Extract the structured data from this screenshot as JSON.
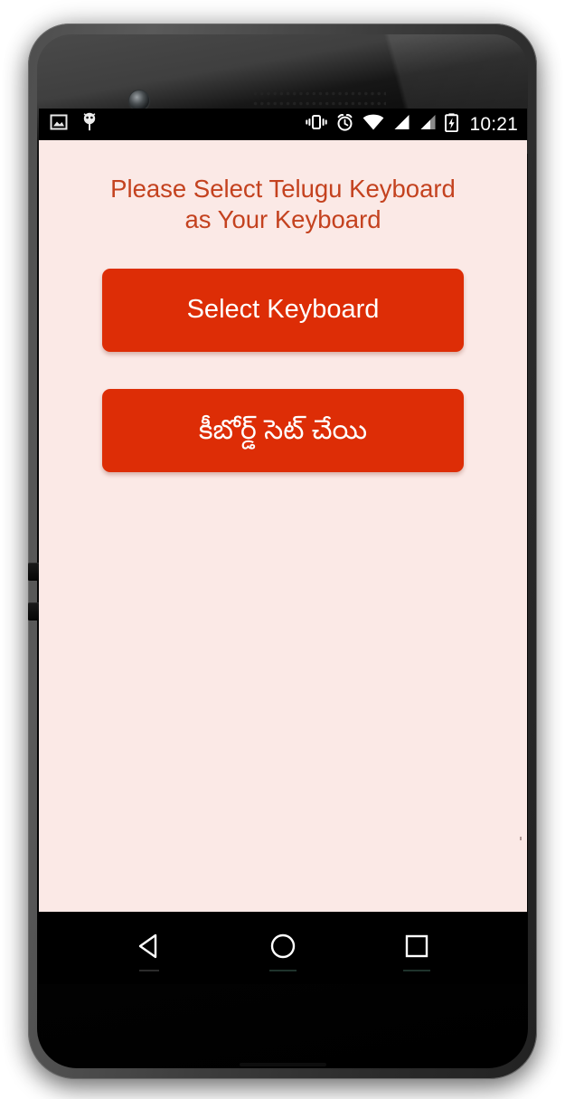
{
  "device": {
    "type": "android-phone-mockup",
    "frame_color": "#3c3c3c",
    "camera_icon": "front-camera-dot",
    "speaker_icon": "earpiece-speaker-grille",
    "side_buttons": [
      "volume-up",
      "volume-down"
    ]
  },
  "status_bar": {
    "background": "#000000",
    "time": "10:21",
    "left_icons": [
      {
        "name": "screenshot-image-icon",
        "glyph": "image"
      },
      {
        "name": "android-debug-icon",
        "glyph": "android-bug"
      }
    ],
    "right_icons": [
      {
        "name": "vibrate-icon",
        "glyph": "vibrate"
      },
      {
        "name": "alarm-icon",
        "glyph": "alarm-clock"
      },
      {
        "name": "wifi-icon",
        "glyph": "wifi-full"
      },
      {
        "name": "signal-sim1-icon",
        "glyph": "signal-bars"
      },
      {
        "name": "signal-sim2-icon",
        "glyph": "signal-bars"
      },
      {
        "name": "battery-charging-icon",
        "glyph": "battery-bolt"
      }
    ]
  },
  "app": {
    "background_color": "#FBE9E6",
    "accent_color": "#DD2D06",
    "headline_color": "#C4421F",
    "headline_line1": "Please Select Telugu Keyboard",
    "headline_line2": "as Your Keyboard",
    "buttons": [
      {
        "id": "select-keyboard",
        "label": "Select Keyboard",
        "background": "#DD2D06",
        "text_color": "#FFFFFF"
      },
      {
        "id": "set-keyboard-telugu",
        "label": "కీబోర్డ్ సెట్ చేయి",
        "background": "#DD2D06",
        "text_color": "#FFFFFF"
      }
    ]
  },
  "nav_bar": {
    "background": "#000000",
    "items": [
      {
        "name": "back-button",
        "glyph": "triangle-left"
      },
      {
        "name": "home-button",
        "glyph": "circle"
      },
      {
        "name": "recents-button",
        "glyph": "square"
      }
    ]
  }
}
